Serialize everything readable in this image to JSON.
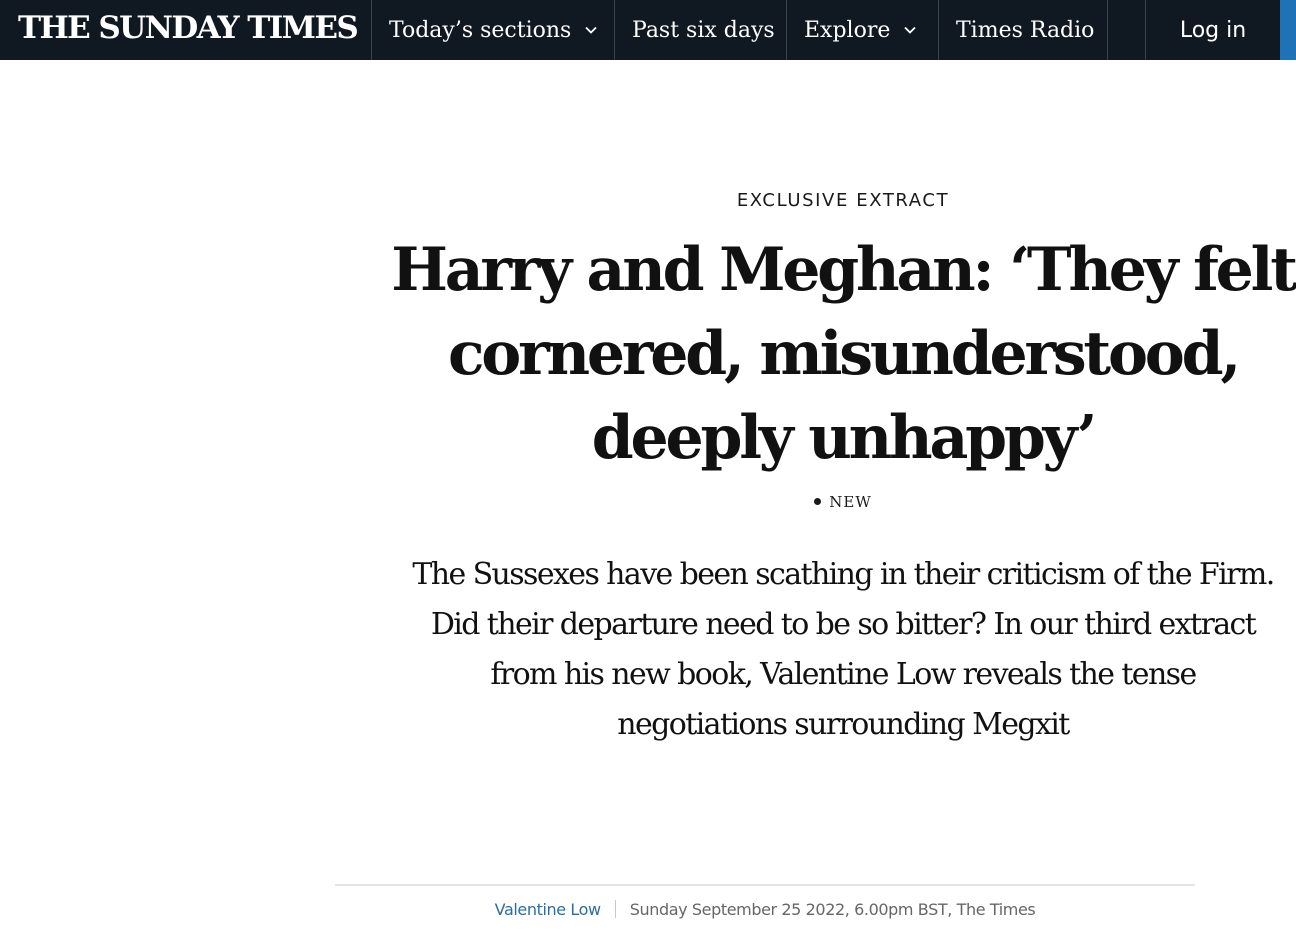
{
  "navbar": {
    "logo": "THE SUNDAY TIMES",
    "items": [
      {
        "label": "Today’s sections",
        "icon": "chevron-down-icon"
      },
      {
        "label": "Past six days"
      },
      {
        "label": "Explore",
        "icon": "chevron-down-icon"
      },
      {
        "label": "Times Radio"
      }
    ],
    "login_label": "Log in",
    "colors": {
      "background": "#101822",
      "accent": "#1e73b8"
    }
  },
  "article": {
    "kicker": "EXCLUSIVE EXTRACT",
    "headline": "Harry and Meghan: ‘They felt cornered, misunderstood, deeply unhappy’",
    "badge": "NEW",
    "standfirst": "The Sussexes have been scathing in their criticism of the Firm. Did their departure need to be so bitter? In our third extract from his new book, Valentine Low reveals the tense negotiations surrounding Megxit",
    "byline": {
      "author": "Valentine Low",
      "date": "Sunday September 25 2022, 6.00pm BST, The Times"
    }
  }
}
